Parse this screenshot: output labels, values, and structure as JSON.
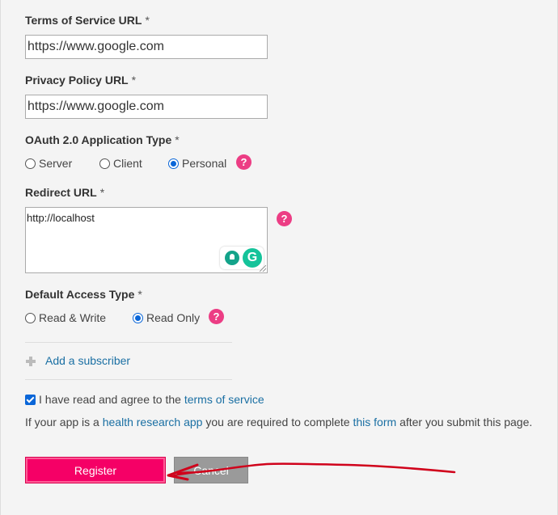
{
  "terms_of_service": {
    "label": "Terms of Service URL",
    "required": "*",
    "value": "https://www.google.com"
  },
  "privacy_policy": {
    "label": "Privacy Policy URL",
    "required": "*",
    "value": "https://www.google.com"
  },
  "oauth_type": {
    "label": "OAuth 2.0 Application Type",
    "required": "*",
    "options": [
      "Server",
      "Client",
      "Personal"
    ],
    "selected": "Personal",
    "help": "?"
  },
  "redirect_url": {
    "label": "Redirect URL",
    "required": "*",
    "value": "http://localhost",
    "help": "?",
    "grammarly_icon": "G"
  },
  "access_type": {
    "label": "Default Access Type",
    "required": "*",
    "options": [
      "Read & Write",
      "Read Only"
    ],
    "selected": "Read Only",
    "help": "?"
  },
  "subscriber": {
    "add_label": "Add a subscriber"
  },
  "agreement": {
    "checked": true,
    "text": "I have read and agree to the",
    "link": "terms of service"
  },
  "info": {
    "part1": "If your app is a",
    "link1": "health research app",
    "part2": "you are required to complete",
    "link2": "this form",
    "part3": "after you submit this page."
  },
  "buttons": {
    "register": "Register",
    "cancel": "Cancel"
  },
  "colors": {
    "accent": "#f50066",
    "link": "#1a6fa3",
    "help": "#ec3d84",
    "annotation": "#d0021b"
  }
}
